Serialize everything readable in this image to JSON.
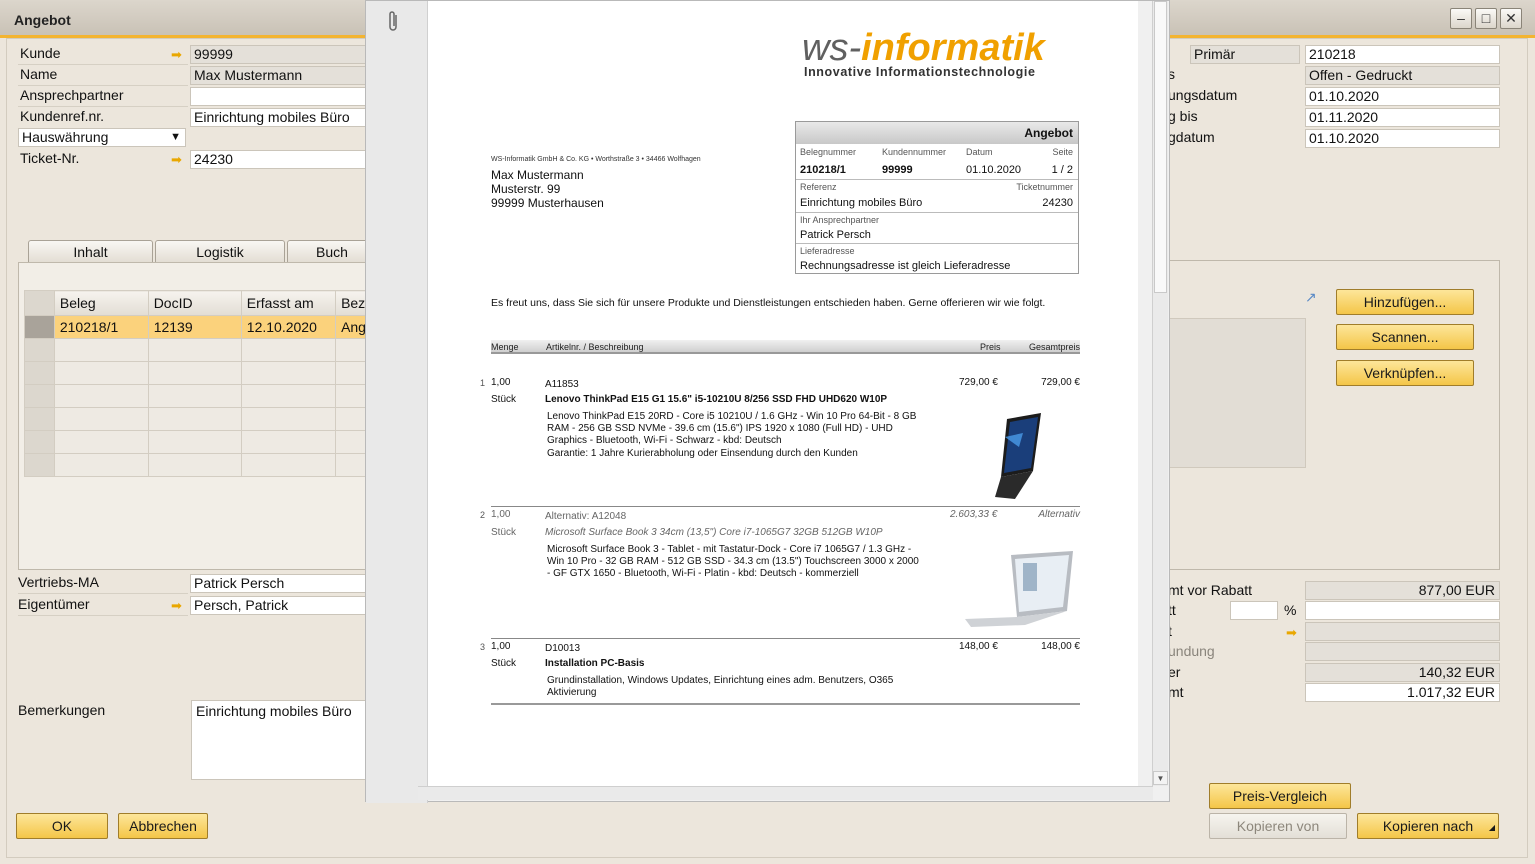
{
  "window": {
    "title": "Angebot"
  },
  "header_left": {
    "kunde_label": "Kunde",
    "kunde_value": "99999",
    "name_label": "Name",
    "name_value": "Max Mustermann",
    "ansprechpartner_label": "Ansprechpartner",
    "ansprechpartner_value": "",
    "kundenref_label": "Kundenref.nr.",
    "kundenref_value": "Einrichtung mobiles Büro",
    "currency_select": "Hauswährung",
    "ticket_label": "Ticket-Nr.",
    "ticket_value": "24230"
  },
  "header_right": {
    "primaer_label": "Primär",
    "primaer_value": "210218",
    "status_label": "s",
    "status_value": "Offen - Gedruckt",
    "buchung_label": "ungsdatum",
    "buchung_value": "01.10.2020",
    "gueltig_label": "g bis",
    "gueltig_value": "01.11.2020",
    "beleg_label": "gdatum",
    "beleg_value": "01.10.2020"
  },
  "tabs": [
    "Inhalt",
    "Logistik",
    "Buch"
  ],
  "grid": {
    "columns": [
      "Beleg",
      "DocID",
      "Erfasst am",
      "Bez"
    ],
    "rows": [
      [
        "210218/1",
        "12139",
        "12.10.2020",
        "Ang"
      ]
    ]
  },
  "attach_buttons": {
    "add": "Hinzufügen...",
    "scan": "Scannen...",
    "link": "Verknüpfen..."
  },
  "footer_left": {
    "vertrieb_label": "Vertriebs-MA",
    "vertrieb_value": "Patrick Persch",
    "eigentuemer_label": "Eigentümer",
    "eigentuemer_value": "Persch, Patrick",
    "bemerkungen_label": "Bemerkungen",
    "bemerkungen_value": "Einrichtung mobiles Büro"
  },
  "totals": {
    "vor_rabatt_label": "mt vor Rabatt",
    "vor_rabatt_value": "877,00 EUR",
    "rabatt_label": "tt",
    "rabatt_percent_sign": "%",
    "fracht_label": "t",
    "rundung_label": "undung",
    "steuer_label": "er",
    "steuer_value": "140,32 EUR",
    "gesamt_label": "mt",
    "gesamt_value": "1.017,32 EUR"
  },
  "buttons": {
    "ok": "OK",
    "cancel": "Abbrechen",
    "price_compare": "Preis-Vergleich",
    "copy_from": "Kopieren von",
    "copy_to": "Kopieren nach"
  },
  "document": {
    "logo_ws": "ws-",
    "logo_informatik": "informatik",
    "logo_tagline": "Innovative Informationstechnologie",
    "sender_line": "WS-Informatik GmbH & Co. KG • Worthstraße 3 • 34466 Wolfhagen",
    "recipient": [
      "Max Mustermann",
      "Musterstr. 99",
      "99999 Musterhausen"
    ],
    "box_title": "Angebot",
    "box_labels": {
      "belegnummer": "Belegnummer",
      "kundennummer": "Kundennummer",
      "datum": "Datum",
      "seite": "Seite",
      "referenz": "Referenz",
      "ticketnummer": "Ticketnummer",
      "ansprechpartner": "Ihr Ansprechpartner",
      "lieferadresse": "Lieferadresse"
    },
    "box_values": {
      "belegnummer": "210218/1",
      "kundennummer": "99999",
      "datum": "01.10.2020",
      "seite": "1 / 2",
      "referenz": "Einrichtung mobiles Büro",
      "ticketnummer": "24230",
      "ansprechpartner": "Patrick Persch",
      "lieferadresse": "Rechnungsadresse ist gleich Lieferadresse"
    },
    "intro": "Es freut uns, dass Sie sich für unsere Produkte und Dienstleistungen entschieden haben. Gerne offerieren wir wie folgt.",
    "table_headers": {
      "menge": "Menge",
      "artikel": "Artikelnr. / Beschreibung",
      "preis": "Preis",
      "gesamt": "Gesamtpreis"
    },
    "items": [
      {
        "pos": "1",
        "qty": "1,00",
        "unit": "Stück",
        "code": "A11853",
        "title": "Lenovo ThinkPad E15 G1 15.6\" i5-10210U 8/256 SSD FHD UHD620 W10P",
        "desc": [
          "Lenovo ThinkPad E15 20RD - Core i5 10210U / 1.6 GHz - Win 10 Pro 64-Bit - 8 GB",
          "RAM - 256 GB SSD NVMe - 39.6 cm (15.6\") IPS 1920 x 1080 (Full HD) - UHD",
          "Graphics - Bluetooth, Wi-Fi - Schwarz - kbd: Deutsch",
          "Garantie: 1 Jahre Kurierabholung oder Einsendung durch den Kunden"
        ],
        "price": "729,00 €",
        "total": "729,00 €"
      },
      {
        "pos": "2",
        "qty": "1,00",
        "unit": "Stück",
        "code": "Alternativ: A12048",
        "title": "Microsoft Surface Book 3 34cm (13,5\") Core i7-1065G7 32GB 512GB W10P",
        "desc": [
          "Microsoft Surface Book 3 - Tablet - mit Tastatur-Dock - Core i7 1065G7 / 1.3 GHz -",
          "Win 10 Pro - 32 GB RAM - 512 GB SSD - 34.3 cm (13.5\") Touchscreen 3000 x 2000",
          "- GF GTX 1650 - Bluetooth, Wi-Fi - Platin - kbd: Deutsch - kommerziell"
        ],
        "price": "2.603,33 €",
        "total": "Alternativ"
      },
      {
        "pos": "3",
        "qty": "1,00",
        "unit": "Stück",
        "code": "D10013",
        "title": "Installation PC-Basis",
        "desc": [
          "Grundinstallation, Windows Updates, Einrichtung eines adm. Benutzers, O365",
          "Aktivierung"
        ],
        "price": "148,00 €",
        "total": "148,00 €"
      }
    ]
  }
}
